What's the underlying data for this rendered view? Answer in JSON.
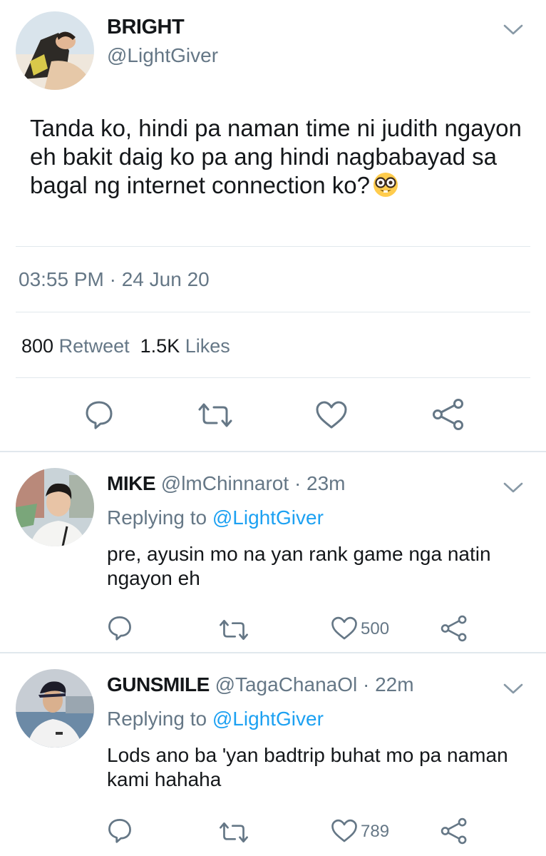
{
  "main_tweet": {
    "name": "BRIGHT",
    "handle": "@LightGiver",
    "text": "Tanda ko, hindi pa naman time ni judith ngayon eh bakit daig ko pa ang hindi nagbabayad sa bagal ng internet connection ko?",
    "emoji": "nerd-face-emoji",
    "timestamp": "03:55 PM · 24 Jun 20",
    "retweet_count": "800",
    "retweet_label": "Retweet",
    "likes_count": "1.5K",
    "likes_label": "Likes"
  },
  "replies": [
    {
      "name": "MIKE",
      "handle": "@lmChinnarot",
      "time": "· 23m",
      "replying_prefix": "Replying to",
      "replying_to": "@LightGiver",
      "text": "pre, ayusin mo na yan rank game nga natin ngayon eh",
      "likes": "500"
    },
    {
      "name": "GUNSMILE",
      "handle": "@TagaChanaOl",
      "time": "· 22m",
      "replying_prefix": "Replying to",
      "replying_to": "@LightGiver",
      "text": "Lods ano ba 'yan badtrip buhat mo pa naman kami hahaha",
      "likes": "789"
    }
  ],
  "icons": [
    "reply-icon",
    "retweet-icon",
    "like-icon",
    "share-icon",
    "chevron-down-icon"
  ],
  "colors": {
    "text": "#14171a",
    "secondary": "#657786",
    "link": "#1da1f2",
    "divider": "#e1e8ed"
  }
}
